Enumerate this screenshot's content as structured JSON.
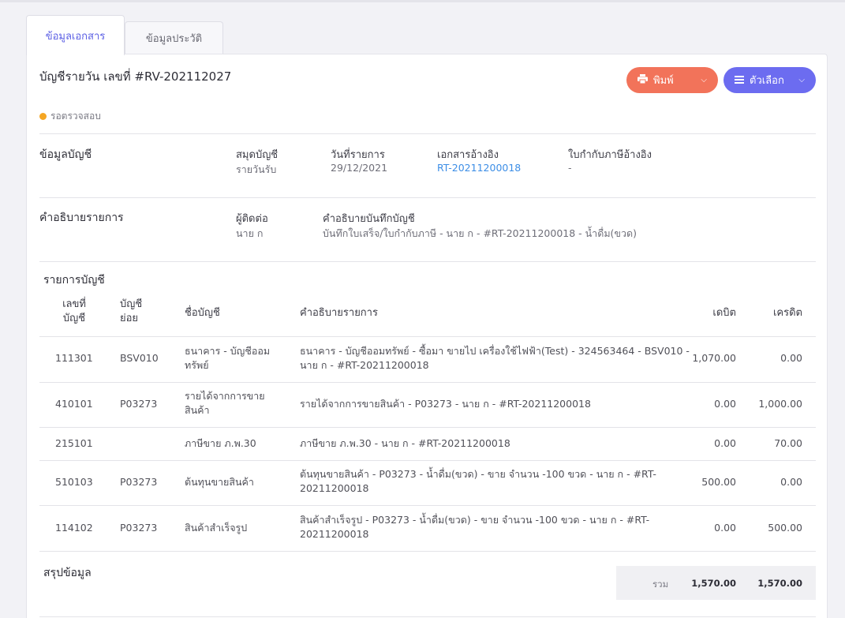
{
  "tabs": [
    {
      "label": "ข้อมูลเอกสาร"
    },
    {
      "label": "ข้อมูลประวัติ"
    }
  ],
  "doc": {
    "title": "บัญชีรายวัน เลขที่ #RV-202112027",
    "status": "รอตรวจสอบ",
    "status_color": "#f5a623"
  },
  "buttons": {
    "print": "พิมพ์",
    "options": "ตัวเลือก",
    "print_color": "#f2735a",
    "options_color": "#6c6cf0"
  },
  "account_info": {
    "section_title": "ข้อมูลบัญชี",
    "book_label": "สมุดบัญชี",
    "book_value": "รายวันรับ",
    "date_label": "วันที่รายการ",
    "date_value": "29/12/2021",
    "ref_label": "เอกสารอ้างอิง",
    "ref_value": "RT-20211200018",
    "tax_label": "ใบกำกับภาษีอ้างอิง",
    "tax_value": "-"
  },
  "description": {
    "section_title": "คำอธิบายรายการ",
    "contact_label": "ผู้ติดต่อ",
    "contact_value": "นาย ก",
    "note_label": "คำอธิบายบันทึกบัญชี",
    "note_value": "บันทึกใบเสร็จ/ใบกำกับภาษี - นาย ก - #RT-20211200018 - น้ำดื่ม(ขวด)"
  },
  "entries": {
    "section_title": "รายการบัญชี",
    "headers": {
      "acc_no_1": "เลขที่",
      "acc_no_2": "บัญชี",
      "sub_1": "บัญชี",
      "sub_2": "ย่อย",
      "name": "ชื่อบัญชี",
      "desc": "คำอธิบายรายการ",
      "debit": "เดบิต",
      "credit": "เครดิต"
    },
    "rows": [
      {
        "acc": "111301",
        "sub": "BSV010",
        "name1": "ธนาคาร - บัญชีออม",
        "name2": "ทรัพย์",
        "desc1": "ธนาคาร - บัญชีออมทรัพย์ - ซื้อมา ขายไป เครื่องใช้ไฟฟ้า(Test) - 324563464 - BSV010 -",
        "desc2": "นาย ก - #RT-20211200018",
        "debit": "1,070.00",
        "credit": "0.00"
      },
      {
        "acc": "410101",
        "sub": "P03273",
        "name1": "รายได้จากการขาย",
        "name2": "สินค้า",
        "desc1": "รายได้จากการขายสินค้า - P03273 - นาย ก - #RT-20211200018",
        "desc2": "",
        "debit": "0.00",
        "credit": "1,000.00"
      },
      {
        "acc": "215101",
        "sub": "",
        "name1": "ภาษีขาย ภ.พ.30",
        "name2": "",
        "desc1": "ภาษีขาย ภ.พ.30 - นาย ก - #RT-20211200018",
        "desc2": "",
        "debit": "0.00",
        "credit": "70.00"
      },
      {
        "acc": "510103",
        "sub": "P03273",
        "name1": "ต้นทุนขายสินค้า",
        "name2": "",
        "desc1": "ต้นทุนขายสินค้า - P03273 - น้ำดื่ม(ขวด) - ขาย จำนวน -100 ขวด - นาย ก - #RT-",
        "desc2": "20211200018",
        "debit": "500.00",
        "credit": "0.00"
      },
      {
        "acc": "114102",
        "sub": "P03273",
        "name1": "สินค้าสำเร็จรูป",
        "name2": "",
        "desc1": "สินค้าสำเร็จรูป - P03273 - น้ำดื่ม(ขวด) - ขาย จำนวน -100 ขวด - นาย ก - #RT-",
        "desc2": "20211200018",
        "debit": "0.00",
        "credit": "500.00"
      }
    ]
  },
  "summary": {
    "section_title": "สรุปข้อมูล",
    "total_label": "รวม",
    "total_debit": "1,570.00",
    "total_credit": "1,570.00"
  }
}
